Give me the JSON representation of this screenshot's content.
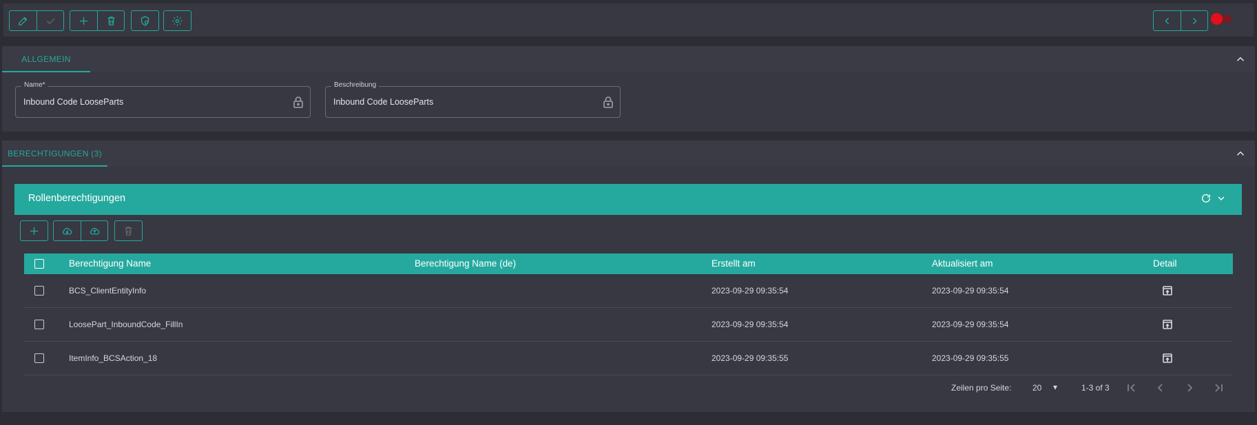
{
  "toolbar": {
    "icons": [
      "pencil-icon",
      "check-icon",
      "plus-icon",
      "trash-icon",
      "shield-icon",
      "gear-icon",
      "chevron-left-icon",
      "chevron-right-icon"
    ],
    "toggle_color": "#e3101c"
  },
  "general": {
    "tab_label": "ALLGEMEIN",
    "name_label": "Name*",
    "name_value": "Inbound Code LooseParts",
    "description_label": "Beschreibung",
    "description_value": "Inbound Code LooseParts"
  },
  "permissions": {
    "tab_label": "BERECHTIGUNGEN (3)",
    "panel_title": "Rollenberechtigungen",
    "columns": [
      "Berechtigung Name",
      "Berechtigung Name (de)",
      "Erstellt am",
      "Aktualisiert am",
      "Detail"
    ],
    "rows": [
      {
        "name": "BCS_ClientEntityInfo",
        "name_de": "",
        "created": "2023-09-29 09:35:54",
        "updated": "2023-09-29 09:35:54"
      },
      {
        "name": "LoosePart_InboundCode_FillIn",
        "name_de": "",
        "created": "2023-09-29 09:35:54",
        "updated": "2023-09-29 09:35:54"
      },
      {
        "name": "ItemInfo_BCSAction_18",
        "name_de": "",
        "created": "2023-09-29 09:35:55",
        "updated": "2023-09-29 09:35:55"
      }
    ],
    "pagination": {
      "rows_per_page_label": "Zeilen pro Seite:",
      "rows_per_page": "20",
      "range": "1-3 of 3"
    }
  },
  "colors": {
    "accent": "#25a99e",
    "background": "#2d2e35",
    "panel": "#373841"
  }
}
